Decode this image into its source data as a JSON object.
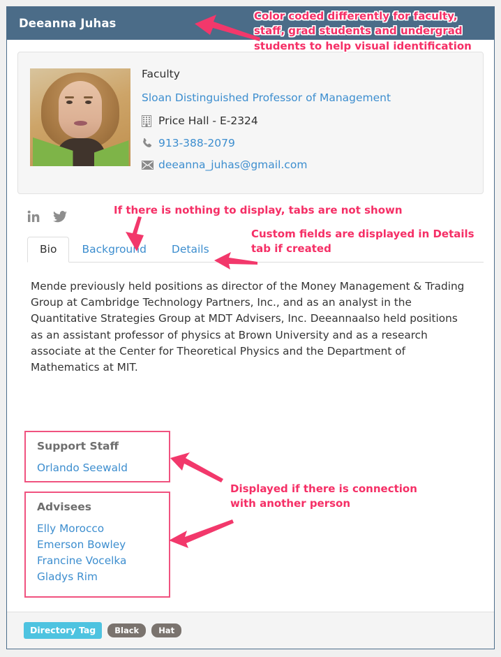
{
  "header": {
    "name": "Deeanna Juhas"
  },
  "contact": {
    "role": "Faculty",
    "job_title": "Sloan Distinguished Professor of Management",
    "office_icon": "building-icon",
    "office": "Price Hall - E-2324",
    "phone_icon": "phone-icon",
    "phone": "913-388-2079",
    "email_icon": "envelope-icon",
    "email": "deeanna_juhas@gmail.com",
    "photo_alt": "Deeanna Juhas profile photo"
  },
  "social": {
    "items": [
      {
        "icon": "linkedin-icon",
        "label": "in"
      },
      {
        "icon": "twitter-icon",
        "label": ""
      }
    ]
  },
  "tabs": [
    {
      "label": "Bio",
      "active": true
    },
    {
      "label": "Background",
      "active": false
    },
    {
      "label": "Details",
      "active": false
    }
  ],
  "bio": {
    "text": "Mende previously held positions as director of the Money Management & Trading Group at Cambridge Technology Partners, Inc., and as an analyst in the Quantitative Strategies Group at MDT Advisers, Inc. Deeannaalso held positions as an assistant professor of physics at Brown University and as a research associate at the Center for Theoretical Physics and the Department of Mathematics at MIT."
  },
  "support_staff": {
    "title": "Support Staff",
    "people": [
      "Orlando Seewald"
    ]
  },
  "advisees": {
    "title": "Advisees",
    "people": [
      "Elly Morocco",
      "Emerson Bowley",
      "Francine Vocelka",
      "Gladys Rim"
    ]
  },
  "footer": {
    "primary_tag": "Directory Tag",
    "tags": [
      "Black",
      "Hat"
    ]
  },
  "annotations": {
    "color_coded": "Color coded differently for faculty, staff, grad students and undergrad students to help visual identification",
    "no_tabs": "If there is nothing to display, tabs are not shown",
    "custom_fields": "Custom fields are displayed in Details tab if created",
    "connection": "Displayed if there is connection with another person"
  },
  "colors": {
    "header_bg": "#4b6c88",
    "link": "#3d8ecf",
    "annotation": "#f52f66",
    "annotation_box_border": "#f0527f",
    "tag_primary_bg": "#4ec3e0",
    "tag_pill_bg": "#7a736e"
  }
}
